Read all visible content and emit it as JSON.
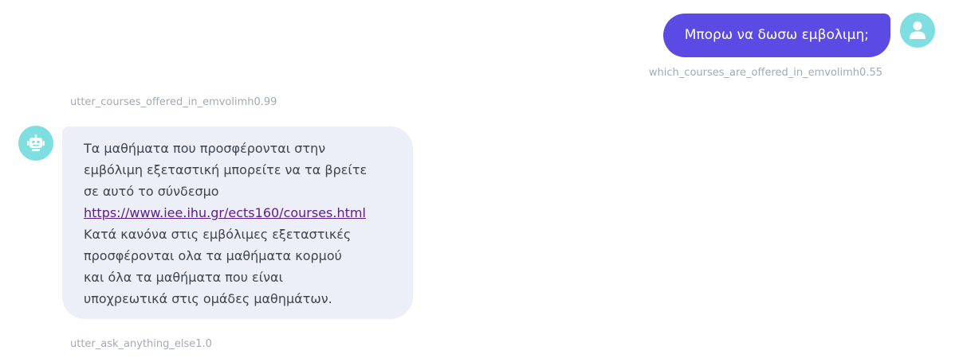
{
  "user_message": {
    "text": "Μπορω να δωσω εμβολιμη;",
    "intent": "which_courses_are_offered_in_emvolimh0.55",
    "avatar_icon": "user-icon"
  },
  "bot_message": {
    "utter_name": "utter_courses_offered_in_emvolimh0.99",
    "avatar_icon": "robot-icon",
    "lines": [
      "Τα μαθήματα που προσφέρονται στην",
      "εμβόλιμη εξεταστική μπορείτε να τα βρείτε",
      "σε αυτό το σύνδεσμο"
    ],
    "link": "https://www.iee.ihu.gr/ects160/courses.html",
    "lines_after": [
      "Κατά κανόνα στις εμβόλιμες εξεταστικές",
      "προσφέρονται ολα τα μαθήματα κορμού",
      "και όλα τα μαθήματα που είναι",
      "υποχρεωτικά στις ομάδες μαθημάτων."
    ]
  },
  "next_utter": "utter_ask_anything_else1.0",
  "colors": {
    "user_bubble": "#5b4ae3",
    "avatar": "#7fdfe0",
    "bot_bubble": "#eceff8",
    "label": "#a3a9b6",
    "link": "#5b1c8c"
  }
}
